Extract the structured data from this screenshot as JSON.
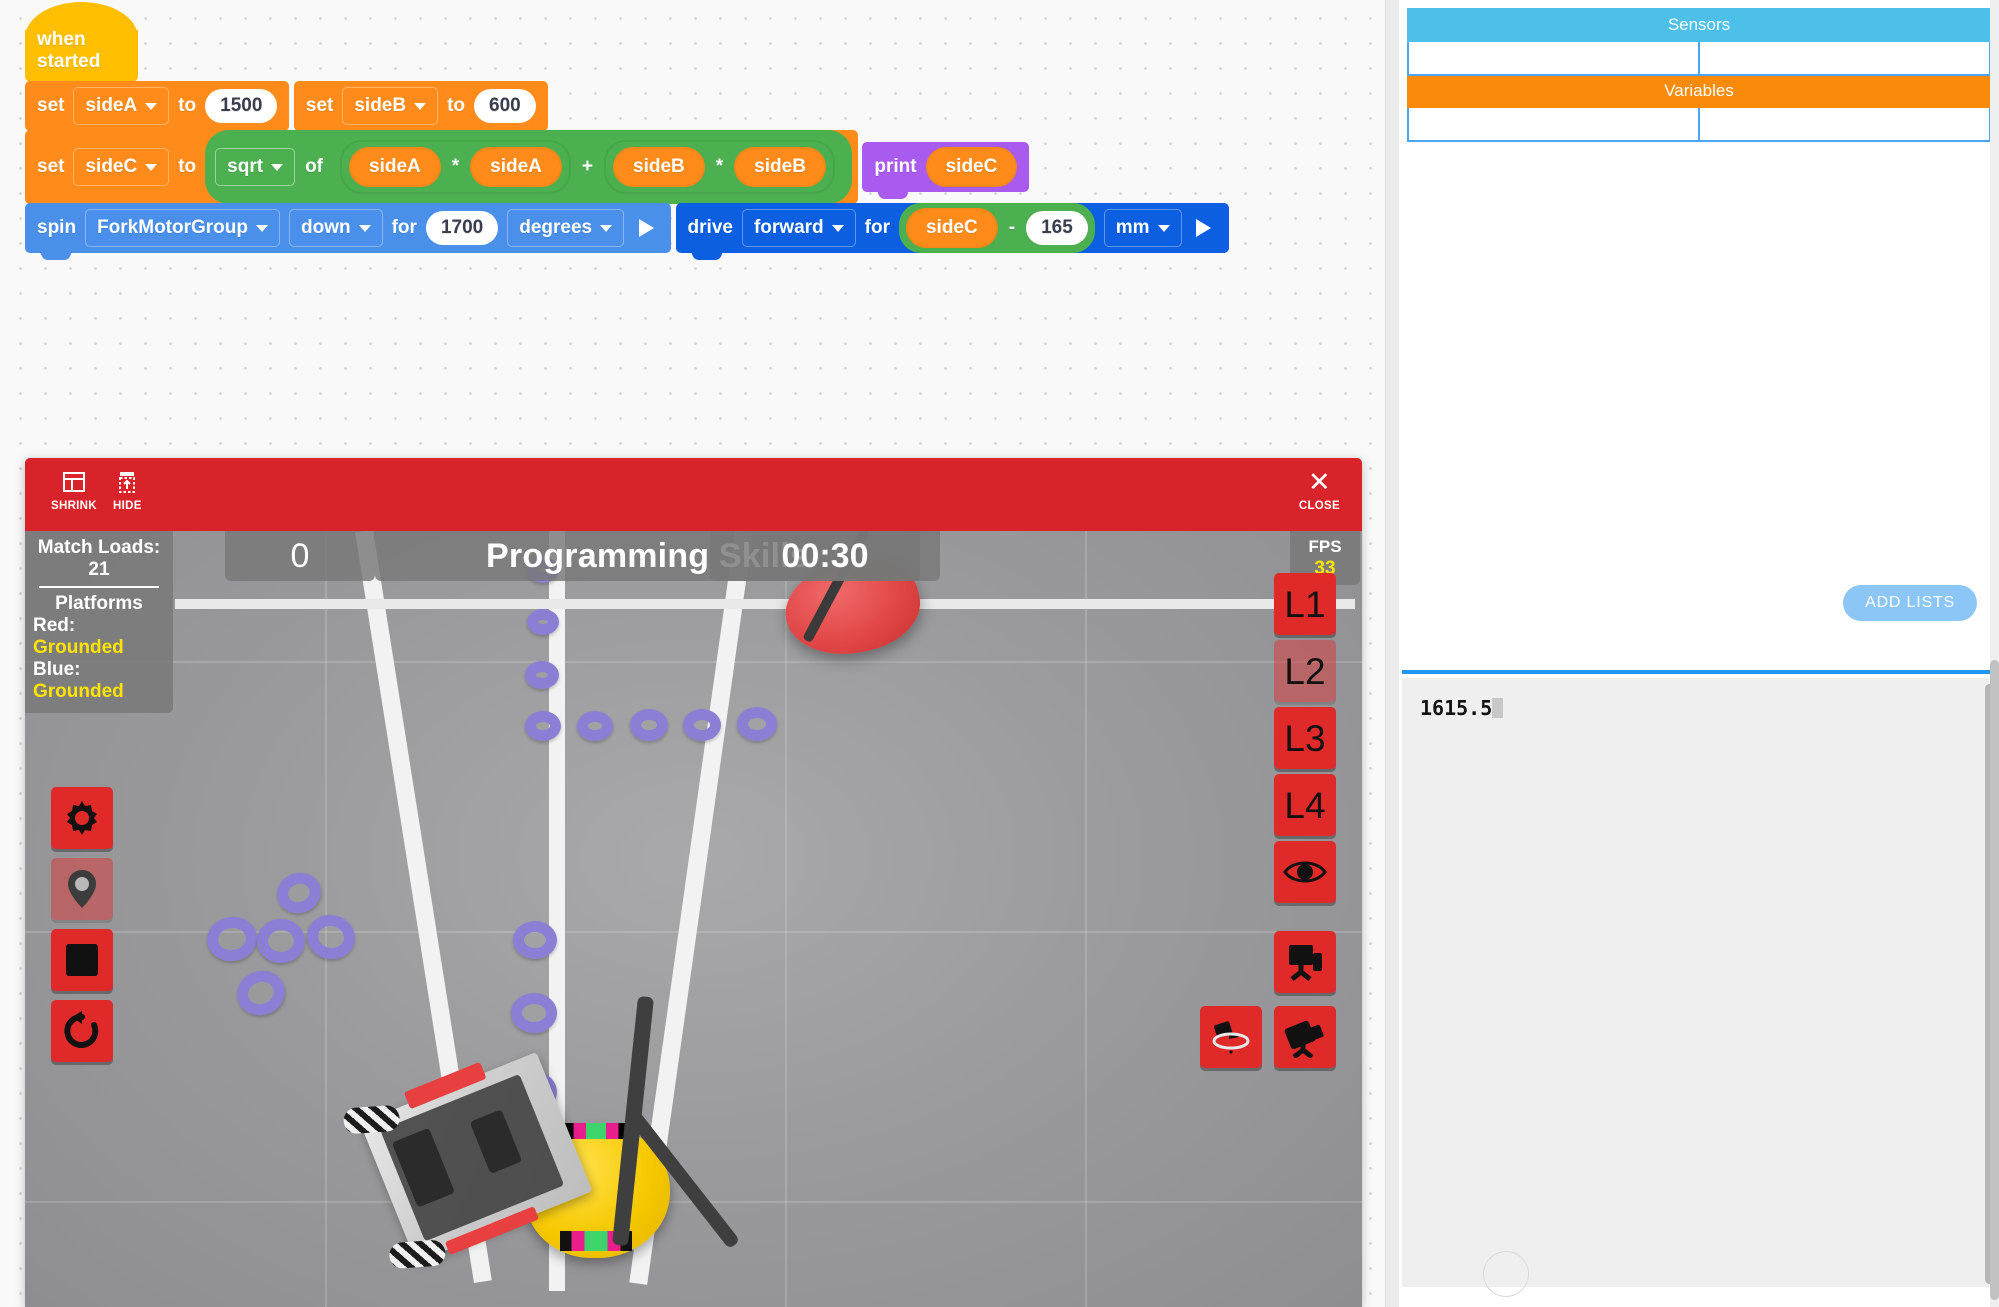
{
  "workspace": {
    "blocks": [
      {
        "type": "hat",
        "label": "when started"
      },
      {
        "type": "set",
        "keyword": "set",
        "variable": "sideA",
        "to": "to",
        "value": "1500"
      },
      {
        "type": "set",
        "keyword": "set",
        "variable": "sideB",
        "to": "to",
        "value": "600"
      },
      {
        "type": "set_expr",
        "keyword": "set",
        "variable": "sideC",
        "to": "to",
        "func": "sqrt",
        "of": "of",
        "operands": [
          "sideA",
          "sideA",
          "sideB",
          "sideB"
        ],
        "ops": [
          "*",
          "+",
          "*"
        ]
      },
      {
        "type": "print",
        "keyword": "print",
        "value": "sideC"
      },
      {
        "type": "spin",
        "keyword": "spin",
        "motor": "ForkMotorGroup",
        "direction": "down",
        "for": "for",
        "amount": "1700",
        "unit": "degrees"
      },
      {
        "type": "drive",
        "keyword": "drive",
        "direction": "forward",
        "for": "for",
        "left_operand": "sideC",
        "operator": "-",
        "right_operand": "165",
        "unit": "mm"
      }
    ]
  },
  "simulator": {
    "toolbar": {
      "shrink_label": "SHRINK",
      "hide_label": "HIDE",
      "close_label": "CLOSE",
      "close_glyph": "✕",
      "bar_color": "#d8232a"
    },
    "hud": {
      "match_loads_label": "Match Loads: 21",
      "platforms_label": "Platforms",
      "red_label": "Red:",
      "red_value": "Grounded",
      "blue_label": "Blue:",
      "blue_value": "Grounded",
      "value_color": "#ffe400"
    },
    "scoreboard": {
      "score": "0",
      "title": "Programming Skills",
      "timer": "00:30",
      "fps_label": "FPS",
      "fps_value": "33"
    },
    "left_buttons": [
      {
        "name": "settings",
        "icon": "gear-icon",
        "dim": false
      },
      {
        "name": "location",
        "icon": "map-pin-icon",
        "dim": true
      },
      {
        "name": "stop",
        "icon": "stop-square-icon",
        "dim": false
      },
      {
        "name": "reset",
        "icon": "reset-rotate-icon",
        "dim": false
      }
    ],
    "right_buttons": [
      {
        "name": "level-1",
        "label": "L1",
        "dim": false
      },
      {
        "name": "level-2",
        "label": "L2",
        "dim": true
      },
      {
        "name": "level-3",
        "label": "L3",
        "dim": false
      },
      {
        "name": "level-4",
        "label": "L4",
        "dim": false
      },
      {
        "name": "view",
        "icon": "eye-icon",
        "dim": false
      },
      {
        "name": "camera-fixed",
        "icon": "camera-tripod-icon",
        "dim": false
      }
    ],
    "bottom_buttons": [
      {
        "name": "camera-orbit",
        "icon": "camera-orbit-icon",
        "dim": false
      },
      {
        "name": "camera-follow",
        "icon": "camera-follow-icon",
        "dim": false
      }
    ]
  },
  "monitor": {
    "sensors_label": "Sensors",
    "variables_label": "Variables",
    "sensors_color": "#4cc0e8",
    "variables_color": "#f98a0a",
    "add_lists_label": "ADD LISTS"
  },
  "console": {
    "output": "1615.5"
  }
}
